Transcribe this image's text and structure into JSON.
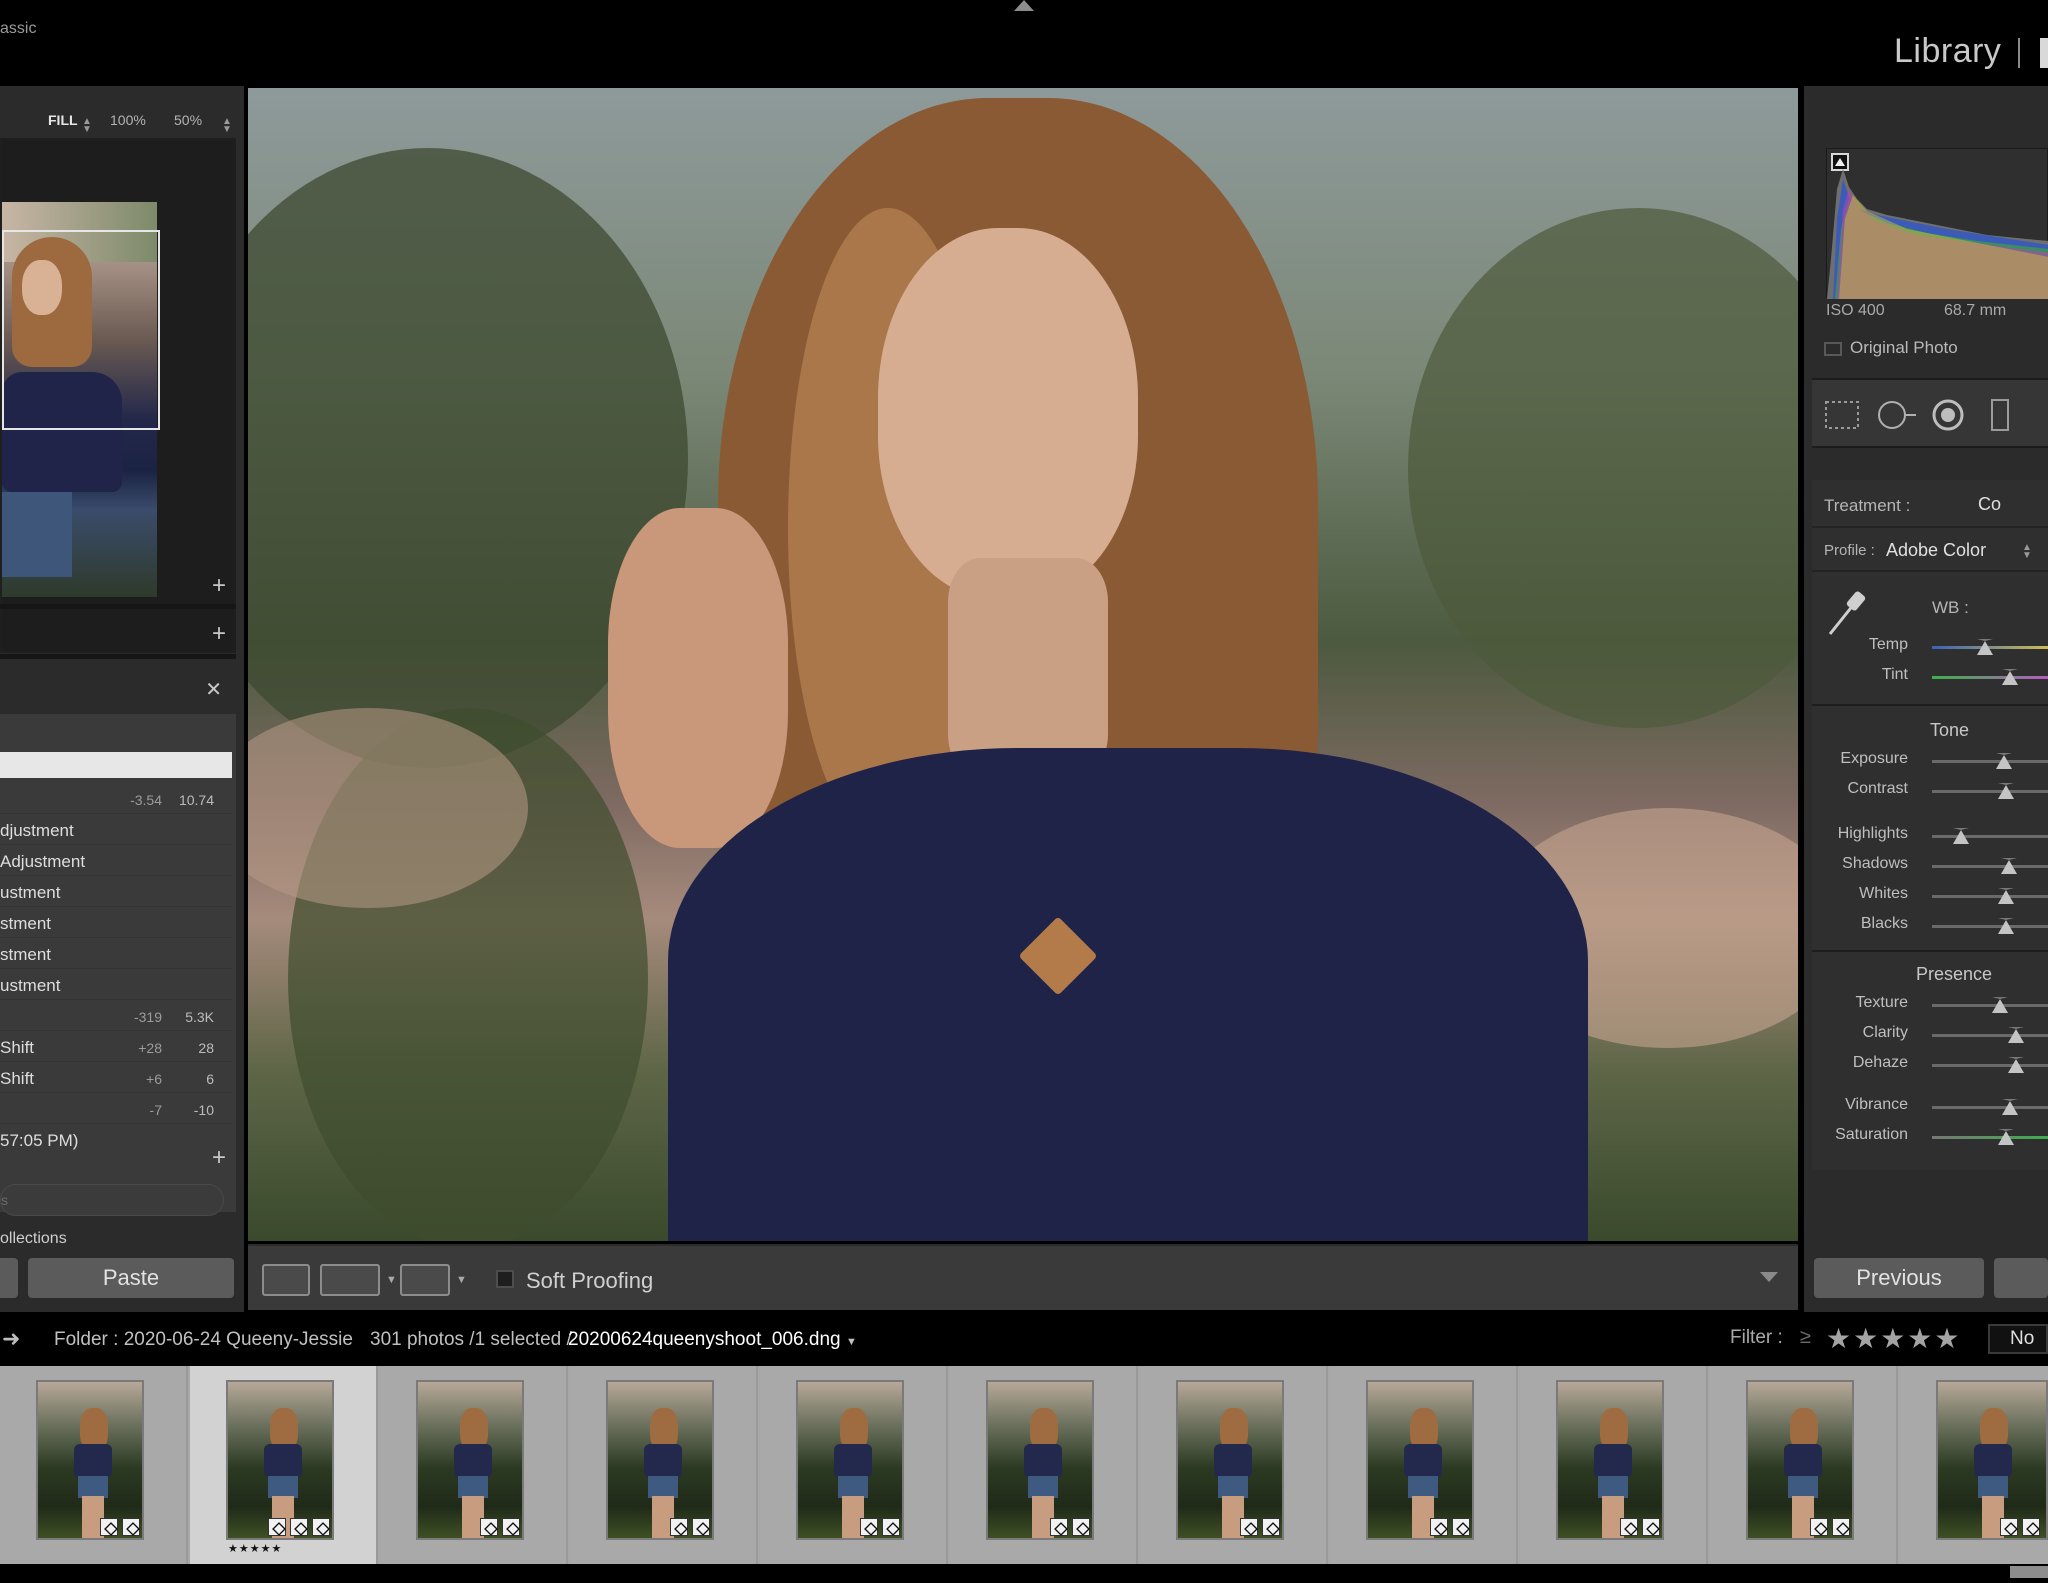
{
  "app": {
    "title": "assic"
  },
  "modules": {
    "active": "Library"
  },
  "navigator": {
    "zoom_fill": "FILL",
    "zoom_100": "100%",
    "zoom_50": "50%"
  },
  "history": {
    "header_value_1": "-3.54",
    "header_value_2": "10.74",
    "items": [
      {
        "label": "djustment",
        "v1": "",
        "v2": ""
      },
      {
        "label": "Adjustment",
        "v1": "",
        "v2": ""
      },
      {
        "label": "ustment",
        "v1": "",
        "v2": ""
      },
      {
        "label": "stment",
        "v1": "",
        "v2": ""
      },
      {
        "label": "stment",
        "v1": "",
        "v2": ""
      },
      {
        "label": "ustment",
        "v1": "",
        "v2": ""
      },
      {
        "label": "",
        "v1": "-319",
        "v2": "5.3K"
      },
      {
        "label": " Shift",
        "v1": "+28",
        "v2": "28"
      },
      {
        "label": "Shift",
        "v1": "+6",
        "v2": "6"
      },
      {
        "label": "",
        "v1": "-7",
        "v2": "-10"
      },
      {
        "label": "57:05 PM)",
        "v1": "",
        "v2": ""
      }
    ]
  },
  "collections": {
    "search_placeholder": "s",
    "first_item": "ollections"
  },
  "left_buttons": {
    "paste": "Paste"
  },
  "toolbar": {
    "soft_proofing": "Soft Proofing"
  },
  "right": {
    "iso": "ISO 400",
    "focal": "68.7 mm",
    "original_photo": "Original Photo",
    "treatment_label": "Treatment :",
    "treatment_value": "Co",
    "profile_label": "Profile :",
    "profile_value": "Adobe Color",
    "wb_label": "WB :",
    "tone_title": "Tone",
    "presence_title": "Presence",
    "previous": "Previous",
    "sliders": {
      "temp": {
        "label": "Temp",
        "pos": 0.44
      },
      "tint": {
        "label": "Tint",
        "pos": 0.65
      },
      "exposure": {
        "label": "Exposure",
        "pos": 0.6
      },
      "contrast": {
        "label": "Contrast",
        "pos": 0.62
      },
      "highlights": {
        "label": "Highlights",
        "pos": 0.24
      },
      "shadows": {
        "label": "Shadows",
        "pos": 0.64
      },
      "whites": {
        "label": "Whites",
        "pos": 0.62
      },
      "blacks": {
        "label": "Blacks",
        "pos": 0.62
      },
      "texture": {
        "label": "Texture",
        "pos": 0.57
      },
      "clarity": {
        "label": "Clarity",
        "pos": 0.7
      },
      "dehaze": {
        "label": "Dehaze",
        "pos": 0.7
      },
      "vibrance": {
        "label": "Vibrance",
        "pos": 0.65
      },
      "saturation": {
        "label": "Saturation",
        "pos": 0.62
      }
    }
  },
  "filmstrip": {
    "folder": "Folder : 2020-06-24 Queeny-Jessie",
    "count": "301 photos /1 selected /",
    "file": "20200624queenyshoot_006.dng",
    "filter_label": "Filter :",
    "filter_ge": "≥",
    "stars": "★★★★★",
    "no_filter": "No",
    "selected_index": 1,
    "selected_rating": "★★★★★"
  },
  "colors": {
    "panel": "#2b2b2b",
    "background": "#000000",
    "filmstrip": "#a7a7a7"
  }
}
